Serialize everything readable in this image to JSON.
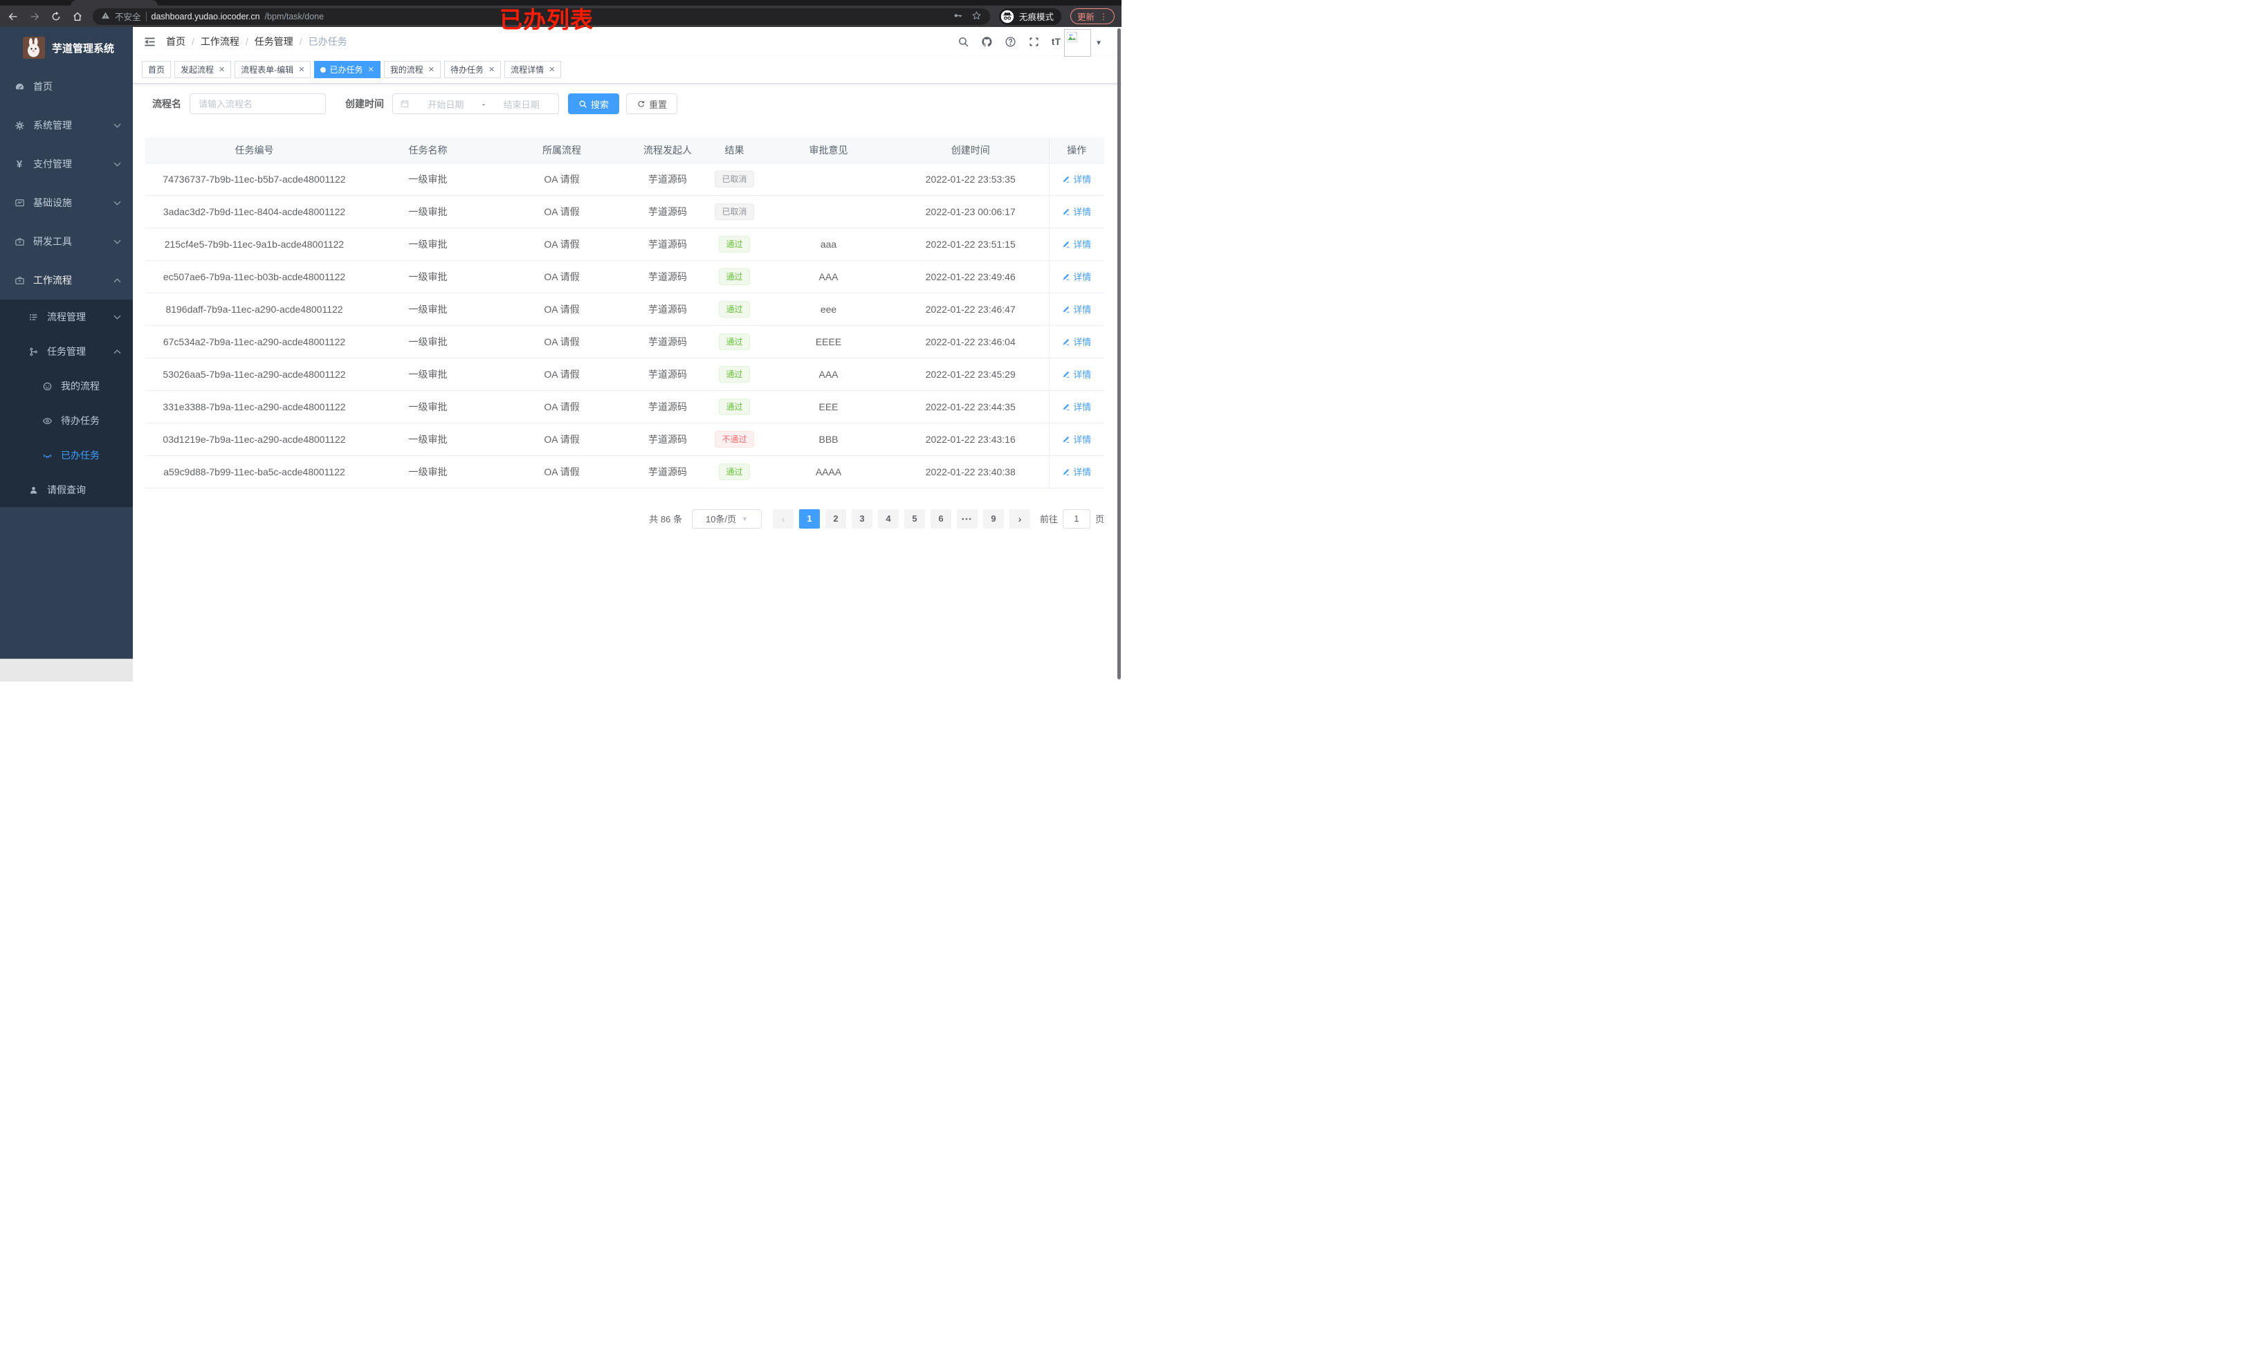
{
  "browser": {
    "security_label": "不安全",
    "url_host": "dashboard.yudao.iocoder.cn",
    "url_path": "/bpm/task/done",
    "incognito_label": "无痕模式",
    "update_label": "更新",
    "menu_dots": "⋮"
  },
  "annotation": {
    "text": "已办列表",
    "color": "#ff1b00"
  },
  "sidebar": {
    "logo_title": "芋道管理系统",
    "items": [
      {
        "label": "首页",
        "icon": "dashboard-icon",
        "level": 1
      },
      {
        "label": "系统管理",
        "icon": "gear-icon",
        "level": 1,
        "chevron": "down"
      },
      {
        "label": "支付管理",
        "icon": "yen-icon",
        "level": 1,
        "chevron": "down"
      },
      {
        "label": "基础设施",
        "icon": "monitor-icon",
        "level": 1,
        "chevron": "down"
      },
      {
        "label": "研发工具",
        "icon": "toolbox-icon",
        "level": 1,
        "chevron": "down"
      },
      {
        "label": "工作流程",
        "icon": "toolbox-icon",
        "level": 1,
        "chevron": "up",
        "open": true
      },
      {
        "label": "流程管理",
        "icon": "list-icon",
        "level": 2,
        "chevron": "down",
        "sub": true
      },
      {
        "label": "任务管理",
        "icon": "tree-icon",
        "level": 2,
        "chevron": "up",
        "sub": true
      },
      {
        "label": "我的流程",
        "icon": "face-icon",
        "level": 3,
        "sub": true
      },
      {
        "label": "待办任务",
        "icon": "eye-open-icon",
        "level": 3,
        "sub": true
      },
      {
        "label": "已办任务",
        "icon": "eye-closed-icon",
        "level": 3,
        "sub": true,
        "active": true
      },
      {
        "label": "请假查询",
        "icon": "user-icon",
        "level": 2,
        "sub": true
      }
    ]
  },
  "breadcrumb": {
    "items": [
      "首页",
      "工作流程",
      "任务管理",
      "已办任务"
    ]
  },
  "tabs": [
    {
      "label": "首页"
    },
    {
      "label": "发起流程",
      "closable": true
    },
    {
      "label": "流程表单-编辑",
      "closable": true
    },
    {
      "label": "已办任务",
      "closable": true,
      "active": true
    },
    {
      "label": "我的流程",
      "closable": true
    },
    {
      "label": "待办任务",
      "closable": true
    },
    {
      "label": "流程详情",
      "closable": true
    }
  ],
  "filters": {
    "name_label": "流程名",
    "name_placeholder": "请输入流程名",
    "time_label": "创建时间",
    "start_placeholder": "开始日期",
    "range_separator": "-",
    "end_placeholder": "结束日期",
    "search_label": "搜索",
    "reset_label": "重置"
  },
  "table": {
    "columns": [
      "任务编号",
      "任务名称",
      "所属流程",
      "流程发起人",
      "结果",
      "审批意见",
      "创建时间",
      "操作"
    ],
    "action_label": "详情",
    "rows": [
      {
        "id": "74736737-7b9b-11ec-b5b7-acde48001122",
        "name": "一级审批",
        "process": "OA 请假",
        "starter": "芋道源码",
        "result": "已取消",
        "result_type": "info",
        "comment": "",
        "time": "2022-01-22 23:53:35"
      },
      {
        "id": "3adac3d2-7b9d-11ec-8404-acde48001122",
        "name": "一级审批",
        "process": "OA 请假",
        "starter": "芋道源码",
        "result": "已取消",
        "result_type": "info",
        "comment": "",
        "time": "2022-01-23 00:06:17"
      },
      {
        "id": "215cf4e5-7b9b-11ec-9a1b-acde48001122",
        "name": "一级审批",
        "process": "OA 请假",
        "starter": "芋道源码",
        "result": "通过",
        "result_type": "success",
        "comment": "aaa",
        "time": "2022-01-22 23:51:15"
      },
      {
        "id": "ec507ae6-7b9a-11ec-b03b-acde48001122",
        "name": "一级审批",
        "process": "OA 请假",
        "starter": "芋道源码",
        "result": "通过",
        "result_type": "success",
        "comment": "AAA",
        "time": "2022-01-22 23:49:46"
      },
      {
        "id": "8196daff-7b9a-11ec-a290-acde48001122",
        "name": "一级审批",
        "process": "OA 请假",
        "starter": "芋道源码",
        "result": "通过",
        "result_type": "success",
        "comment": "eee",
        "time": "2022-01-22 23:46:47"
      },
      {
        "id": "67c534a2-7b9a-11ec-a290-acde48001122",
        "name": "一级审批",
        "process": "OA 请假",
        "starter": "芋道源码",
        "result": "通过",
        "result_type": "success",
        "comment": "EEEE",
        "time": "2022-01-22 23:46:04"
      },
      {
        "id": "53026aa5-7b9a-11ec-a290-acde48001122",
        "name": "一级审批",
        "process": "OA 请假",
        "starter": "芋道源码",
        "result": "通过",
        "result_type": "success",
        "comment": "AAA",
        "time": "2022-01-22 23:45:29"
      },
      {
        "id": "331e3388-7b9a-11ec-a290-acde48001122",
        "name": "一级审批",
        "process": "OA 请假",
        "starter": "芋道源码",
        "result": "通过",
        "result_type": "success",
        "comment": "EEE",
        "time": "2022-01-22 23:44:35"
      },
      {
        "id": "03d1219e-7b9a-11ec-a290-acde48001122",
        "name": "一级审批",
        "process": "OA 请假",
        "starter": "芋道源码",
        "result": "不通过",
        "result_type": "danger",
        "comment": "BBB",
        "time": "2022-01-22 23:43:16"
      },
      {
        "id": "a59c9d88-7b99-11ec-ba5c-acde48001122",
        "name": "一级审批",
        "process": "OA 请假",
        "starter": "芋道源码",
        "result": "通过",
        "result_type": "success",
        "comment": "AAAA",
        "time": "2022-01-22 23:40:38"
      }
    ]
  },
  "pagination": {
    "total_label": "共 86 条",
    "page_size_label": "10条/页",
    "prev": "‹",
    "next": "›",
    "pages": [
      "1",
      "2",
      "3",
      "4",
      "5",
      "6",
      "•••",
      "9"
    ],
    "active_page": "1",
    "goto_label": "前往",
    "goto_value": "1",
    "goto_suffix": "页"
  }
}
